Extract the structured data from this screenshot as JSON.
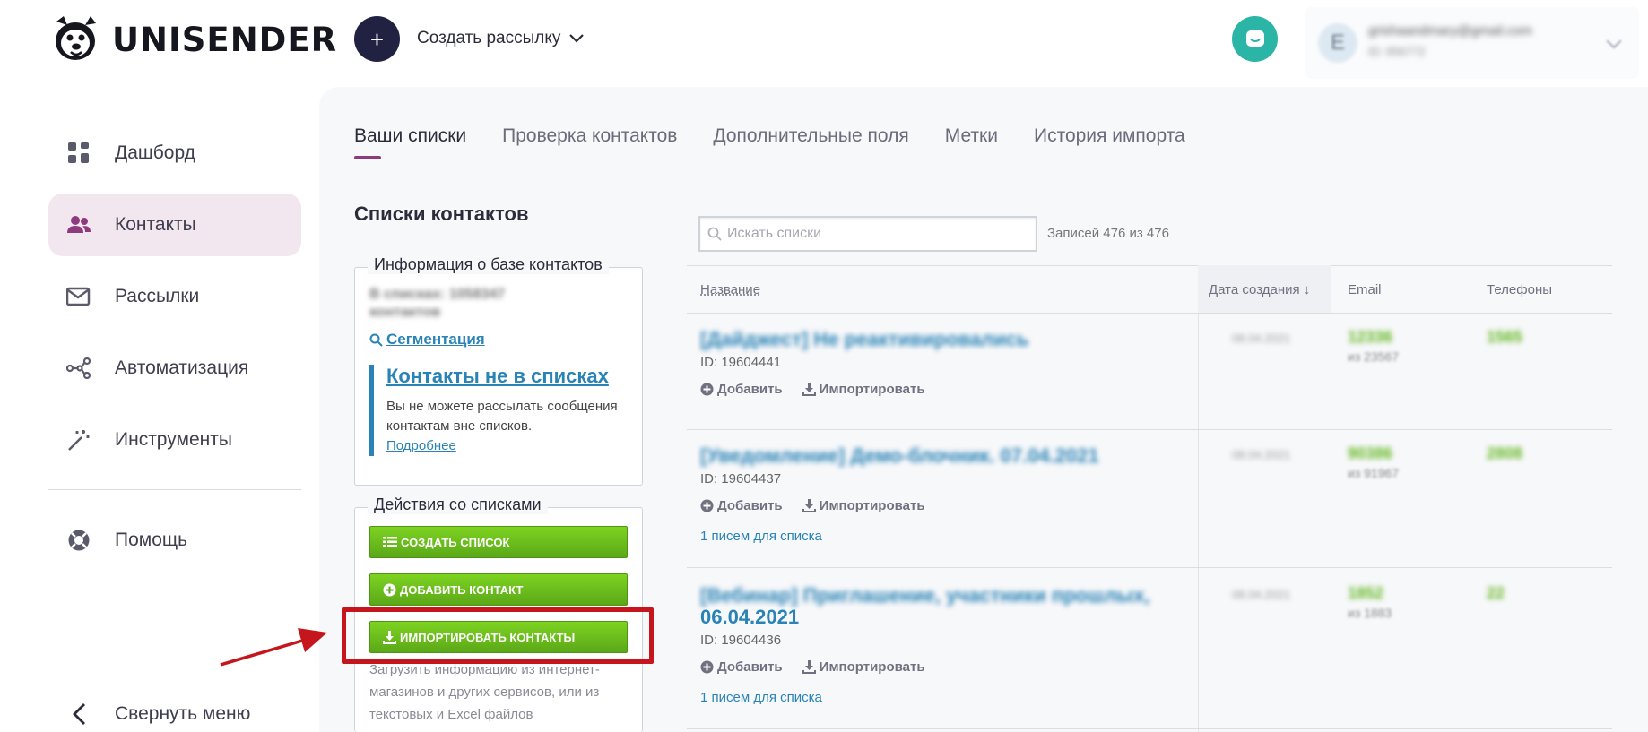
{
  "brand": {
    "name": "UNISENDER",
    "logo_icon": "dog-logo-icon"
  },
  "header": {
    "create_button_symbol": "+",
    "create_label": "Создать рассылку",
    "chat_icon": "chat-icon",
    "account": {
      "avatar_letter": "E",
      "email": "grishaandmary@gmail.com",
      "id": "ID: 856772"
    }
  },
  "sidebar": {
    "items": [
      {
        "label": "Дашборд",
        "icon": "grid-icon",
        "active": false
      },
      {
        "label": "Контакты",
        "icon": "people-icon",
        "active": true
      },
      {
        "label": "Рассылки",
        "icon": "mail-icon",
        "active": false
      },
      {
        "label": "Автоматизация",
        "icon": "flow-icon",
        "active": false
      },
      {
        "label": "Инструменты",
        "icon": "magic-wand-icon",
        "active": false
      },
      {
        "label": "Помощь",
        "icon": "lifebuoy-icon",
        "active": false
      }
    ],
    "collapse_label": "Свернуть меню"
  },
  "tabs": [
    {
      "label": "Ваши списки",
      "active": true
    },
    {
      "label": "Проверка контактов",
      "active": false
    },
    {
      "label": "Дополнительные поля",
      "active": false
    },
    {
      "label": "Метки",
      "active": false
    },
    {
      "label": "История импорта",
      "active": false
    }
  ],
  "section_title": "Списки контактов",
  "info_box": {
    "legend": "Информация о базе контактов",
    "stats_line1": "В списках: 1058347",
    "stats_line2": "контактов",
    "segmentation_link": "Сегментация",
    "callout_title": "Контакты не в списках",
    "callout_text": "Вы не можете рассылать сообщения контактам вне списков.",
    "callout_more": "Подробнее"
  },
  "actions_box": {
    "legend": "Действия со списками",
    "create_list": "СОЗДАТЬ СПИСОК",
    "add_contact": "ДОБАВИТЬ КОНТАКТ",
    "import_contacts": "ИМПОРТИРОВАТЬ КОНТАКТЫ",
    "note": "Загрузить информацию из интернет-магазинов и других сервисов, или из текстовых и Excel файлов"
  },
  "table": {
    "search_placeholder": "Искать списки",
    "records_label": "Записей 476 из 476",
    "columns": {
      "name": "Название",
      "date": "Дата создания ↓",
      "email": "Email",
      "phones": "Телефоны"
    },
    "add_label": "Добавить",
    "import_label": "Импортировать",
    "rows": [
      {
        "name": "[Дайджест] Не реактивировались",
        "name_line2": "",
        "id": "ID: 19604441",
        "date": "08.04.2021",
        "email": "12336",
        "email_sub": "из 23567",
        "phones": "1565",
        "letters": ""
      },
      {
        "name": "[Уведомление] Демо-блочник. 07.04.2021",
        "name_line2": "",
        "id": "ID: 19604437",
        "date": "08.04.2021",
        "email": "90386",
        "email_sub": "из 91967",
        "phones": "2808",
        "letters": "1 писем для списка"
      },
      {
        "name": "[Вебинар] Приглашение, участники прошлых,",
        "name_line2": "06.04.2021",
        "id": "ID: 19604436",
        "date": "08.04.2021",
        "email": "1852",
        "email_sub": "из 1883",
        "phones": "22",
        "letters": "1 писем для списка"
      }
    ]
  }
}
